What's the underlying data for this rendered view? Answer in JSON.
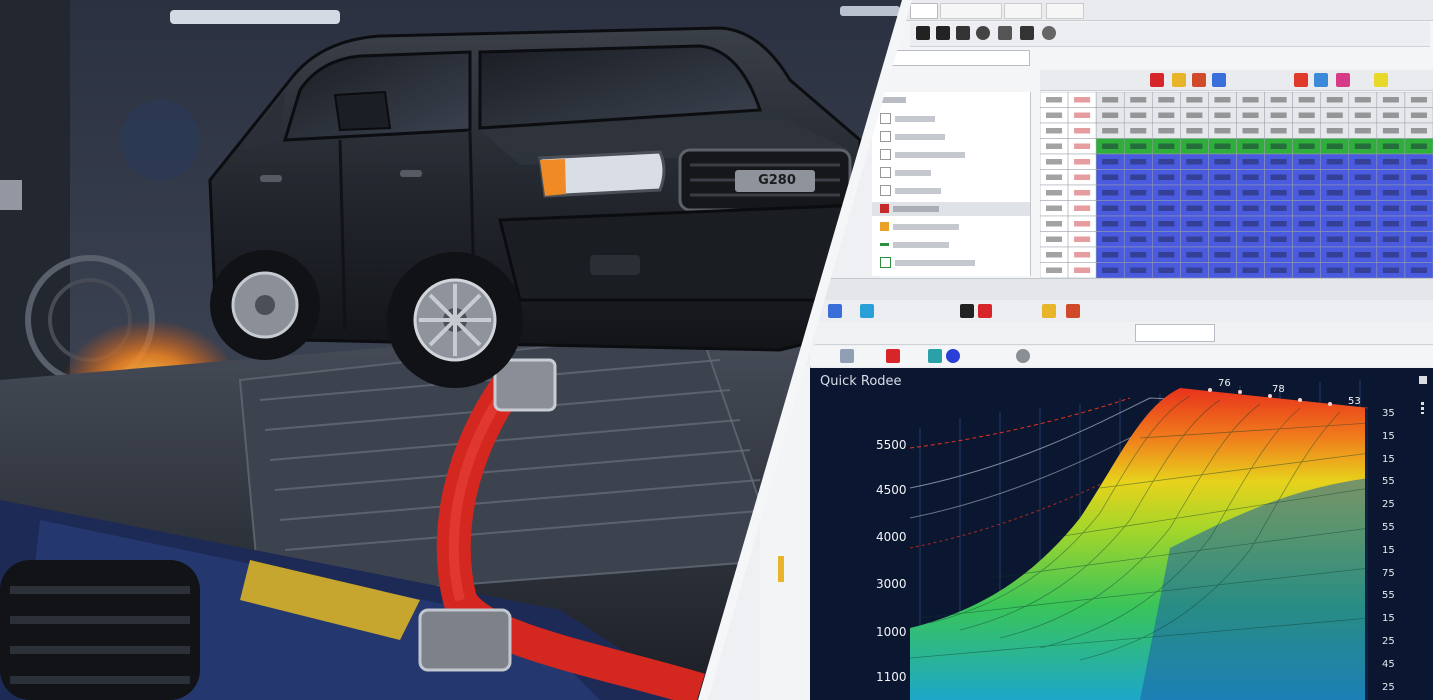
{
  "left_scene": {
    "badge_text": "G280"
  },
  "chart": {
    "title": "Quick Rodee",
    "y_labels": [
      "5500",
      "4500",
      "4000",
      "3000",
      "1000",
      "1100"
    ],
    "right_labels": [
      "35",
      "15",
      "15",
      "55",
      "25",
      "55",
      "15",
      "75",
      "55",
      "15",
      "25",
      "45",
      "25"
    ],
    "top_labels": [
      "76",
      "78",
      "53"
    ]
  },
  "chart_data": {
    "type": "heatmap",
    "title": "Quick Rodee",
    "y_tick_labels": [
      "5500",
      "4500",
      "4000",
      "3000",
      "1000",
      "1100"
    ],
    "right_tick_labels": [
      "35",
      "15",
      "15",
      "55",
      "25",
      "55",
      "15",
      "75",
      "55",
      "15",
      "25",
      "45",
      "25"
    ],
    "top_tick_labels": [
      "76",
      "78",
      "53"
    ]
  },
  "colors": {
    "grid_green": "#2fae3c",
    "grid_blue": "#4a5be0",
    "surface_red": "#e8321c",
    "surface_yellow": "#e8d21c",
    "surface_green": "#39c45a",
    "plot_bg": "#0b1730"
  }
}
